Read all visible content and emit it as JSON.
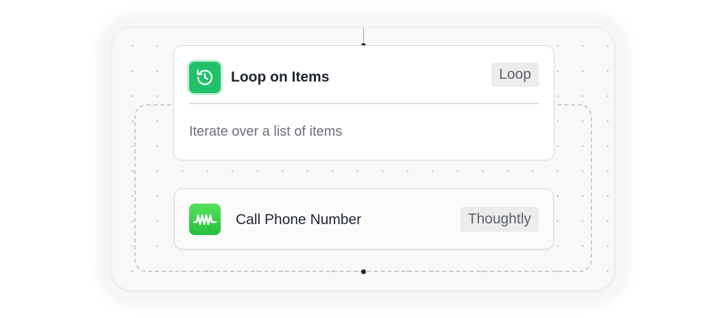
{
  "loop_node": {
    "title": "Loop on Items",
    "badge": "Loop",
    "description": "Iterate over a list of items",
    "icon": "history-icon",
    "accent_color": "#21c16a"
  },
  "step_node": {
    "title": "Call Phone Number",
    "badge": "Thoughtly",
    "icon": "waveform-icon",
    "accent_color": "#3dd54a"
  }
}
